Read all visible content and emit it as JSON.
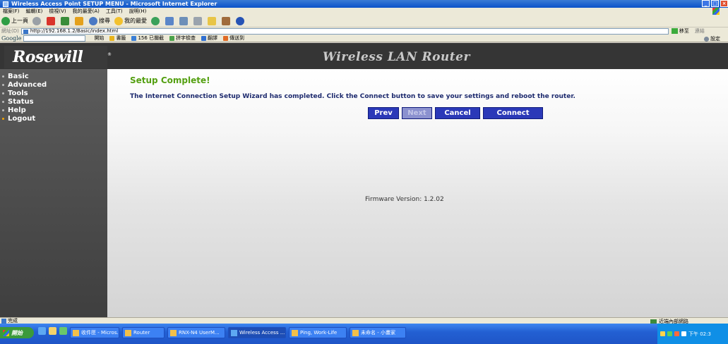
{
  "window": {
    "title": "Wireless Access Point SETUP MENU - Microsoft Internet Explorer"
  },
  "menubar": {
    "items": [
      "檔案(F)",
      "編輯(E)",
      "檢視(V)",
      "我的最愛(A)",
      "工具(T)",
      "說明(H)"
    ]
  },
  "toolbar": {
    "back_label": "上一頁",
    "search_label": "搜尋",
    "favorites_label": "我的最愛"
  },
  "address": {
    "label": "網址(D)",
    "url": "http://192.168.1.2/Basic/index.html",
    "go_label": "移至",
    "links_label": "連結"
  },
  "googlebar": {
    "logo": "Google",
    "start_label": "開始",
    "bookmarks_label": "書籤",
    "blocked_label": "156 已攔截",
    "spell_label": "拼字檢查",
    "translate_label": "翻譯",
    "send_label": "傳送到",
    "settings_label": "設定"
  },
  "router": {
    "logo_text": "Rosewill",
    "header_title": "Wireless LAN Router",
    "nav": [
      {
        "label": "Basic",
        "active": false
      },
      {
        "label": "Advanced",
        "active": false
      },
      {
        "label": "Tools",
        "active": false
      },
      {
        "label": "Status",
        "active": false
      },
      {
        "label": "Help",
        "active": false
      },
      {
        "label": "Logout",
        "active": true
      }
    ],
    "content_title": "Setup Complete!",
    "message": "The Internet Connection Setup Wizard has completed. Click the Connect button to save your settings and reboot the router.",
    "buttons": {
      "prev": "Prev",
      "next": "Next",
      "cancel": "Cancel",
      "connect": "Connect"
    },
    "firmware": "Firmware Version: 1.2.02"
  },
  "statusbar": {
    "status": "完成",
    "zone": "近端內部網路"
  },
  "taskbar": {
    "start": "開始",
    "tasks": [
      "收件匣 - Micros...",
      "Router",
      "RNX-N4 UserM...",
      "Wireless Access ...",
      "Ping, Work-Life",
      "未命名 - 小畫家"
    ],
    "clock": "下午 02:3"
  }
}
